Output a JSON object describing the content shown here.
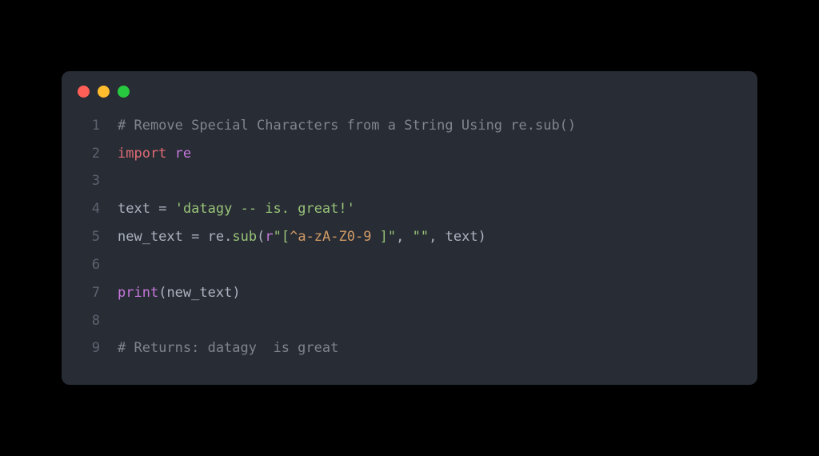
{
  "titlebar": {
    "buttons": {
      "close": "close",
      "minimize": "minimize",
      "zoom": "zoom"
    }
  },
  "code": {
    "lines": [
      {
        "num": "1",
        "tokens": [
          {
            "cls": "tok-comment",
            "t": "# Remove Special Characters from a String Using re.sub()"
          }
        ]
      },
      {
        "num": "2",
        "tokens": [
          {
            "cls": "tok-keyword",
            "t": "import"
          },
          {
            "cls": "",
            "t": " "
          },
          {
            "cls": "tok-module",
            "t": "re"
          }
        ]
      },
      {
        "num": "3",
        "tokens": []
      },
      {
        "num": "4",
        "tokens": [
          {
            "cls": "tok-var",
            "t": "text"
          },
          {
            "cls": "",
            "t": " "
          },
          {
            "cls": "tok-op",
            "t": "="
          },
          {
            "cls": "",
            "t": " "
          },
          {
            "cls": "tok-string",
            "t": "'datagy -- is. great!'"
          }
        ]
      },
      {
        "num": "5",
        "tokens": [
          {
            "cls": "tok-var",
            "t": "new_text"
          },
          {
            "cls": "",
            "t": " "
          },
          {
            "cls": "tok-op",
            "t": "="
          },
          {
            "cls": "",
            "t": " "
          },
          {
            "cls": "tok-var",
            "t": "re"
          },
          {
            "cls": "tok-punct",
            "t": "."
          },
          {
            "cls": "tok-attr",
            "t": "sub"
          },
          {
            "cls": "tok-punct",
            "t": "("
          },
          {
            "cls": "tok-prefix",
            "t": "r"
          },
          {
            "cls": "tok-string",
            "t": "\"["
          },
          {
            "cls": "tok-regex",
            "t": "^a-zA-Z0-9 "
          },
          {
            "cls": "tok-string",
            "t": "]\""
          },
          {
            "cls": "tok-punct",
            "t": ", "
          },
          {
            "cls": "tok-string",
            "t": "\"\""
          },
          {
            "cls": "tok-punct",
            "t": ", "
          },
          {
            "cls": "tok-var",
            "t": "text"
          },
          {
            "cls": "tok-punct",
            "t": ")"
          }
        ]
      },
      {
        "num": "6",
        "tokens": []
      },
      {
        "num": "7",
        "tokens": [
          {
            "cls": "tok-func",
            "t": "print"
          },
          {
            "cls": "tok-punct",
            "t": "("
          },
          {
            "cls": "tok-var",
            "t": "new_text"
          },
          {
            "cls": "tok-punct",
            "t": ")"
          }
        ]
      },
      {
        "num": "8",
        "tokens": []
      },
      {
        "num": "9",
        "tokens": [
          {
            "cls": "tok-comment",
            "t": "# Returns: datagy  is great"
          }
        ]
      }
    ]
  }
}
